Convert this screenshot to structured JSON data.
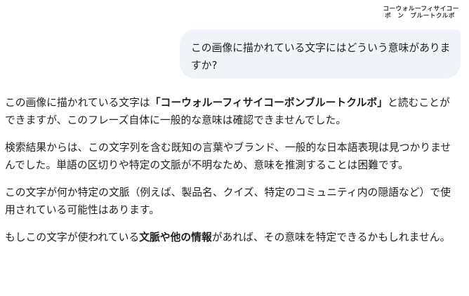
{
  "attached_image": {
    "line1": "コーウォルーフィサイコー",
    "line2": "ボ　ン　ブルートクルボ"
  },
  "user_message": {
    "text": "この画像に描かれている文字にはどういう意味がありますか?"
  },
  "response": {
    "p1_before": "この画像に描かれている文字は",
    "p1_bold": "「コーウォルーフィサイコーボンブルートクルボ」",
    "p1_after": "と読むことができますが、このフレーズ自体に一般的な意味は確認できませんでした。",
    "p2": "検索結果からは、この文字列を含む既知の言葉やブランド、一般的な日本語表現は見つかりませんでした。単語の区切りや特定の文脈が不明なため、意味を推測することは困難です。",
    "p3": "この文字が何か特定の文脈（例えば、製品名、クイズ、特定のコミュニティ内の隠語など）で使用されている可能性はあります。",
    "p4_before": "もしこの文字が使われている",
    "p4_bold": "文脈や他の情報",
    "p4_after": "があれば、その意味を特定できるかもしれません。"
  }
}
